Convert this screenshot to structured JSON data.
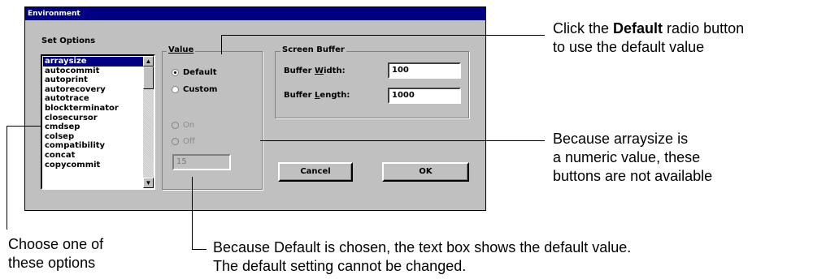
{
  "dialog": {
    "title": "Environment",
    "set_options_label": "Set Options",
    "options": [
      "arraysize",
      "autocommit",
      "autoprint",
      "autorecovery",
      "autotrace",
      "blockterminator",
      "closecursor",
      "cmdsep",
      "colsep",
      "compatibility",
      "concat",
      "copycommit"
    ],
    "selected_option": "arraysize",
    "value_group": {
      "title": "Value",
      "default_label": "Default",
      "custom_label": "Custom",
      "on_label": "On",
      "off_label": "Off",
      "value_text": "15"
    },
    "screen_buffer": {
      "title": "Screen Buffer",
      "width_label": "Buffer Width:",
      "width_value": "100",
      "length_label": "Buffer Length:",
      "length_value": "1000"
    },
    "cancel_label": "Cancel",
    "ok_label": "OK"
  },
  "callouts": {
    "default_radio": [
      "Click the ",
      "Default",
      " radio button",
      "to use the default value"
    ],
    "numeric_note": [
      "Because arraysize is",
      "a numeric value, these",
      "buttons are not available"
    ],
    "choose_note": [
      "Choose one of",
      "these options"
    ],
    "default_text_note": [
      "Because Default is chosen, the text box shows the default value.",
      "The default setting cannot be changed."
    ]
  }
}
